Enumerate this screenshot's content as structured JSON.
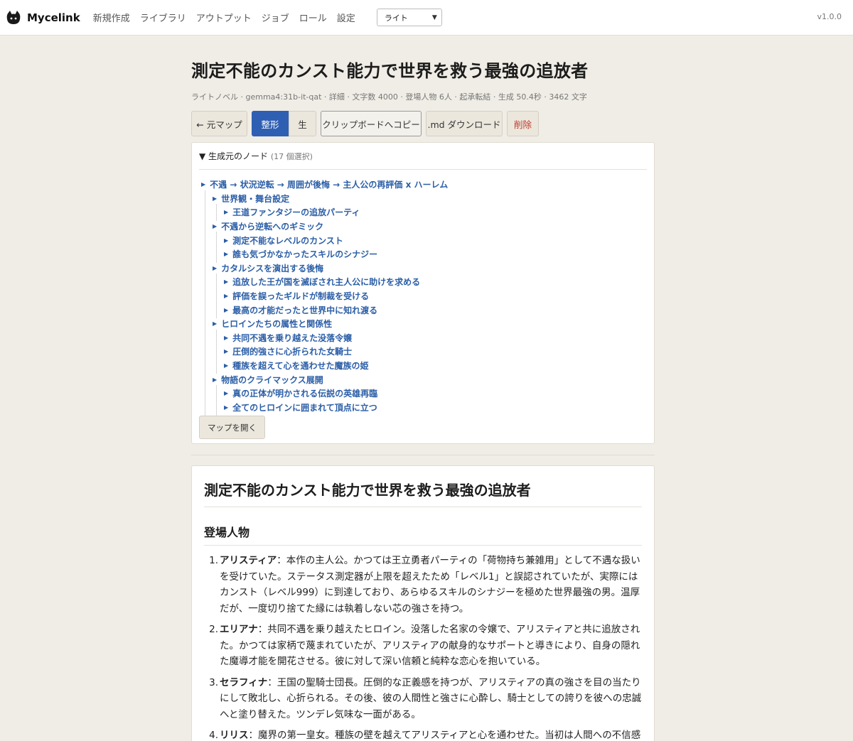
{
  "brand": {
    "name": "Mycelink",
    "icon": "cat-icon"
  },
  "nav": {
    "items": [
      "新規作成",
      "ライブラリ",
      "アウトプット",
      "ジョブ",
      "ロール",
      "設定"
    ],
    "theme_value": "ライト",
    "version": "v1.0.0"
  },
  "page": {
    "title": "測定不能のカンスト能力で世界を救う最強の追放者",
    "meta": "ライトノベル · gemma4:31b-it-qat · 詳細 · 文字数 4000 · 登場人物 6人 · 起承転結 · 生成 50.4秒 · 3462 文字"
  },
  "toolbar": {
    "back": "← 元マップ",
    "formatted": "整形",
    "raw": "生",
    "copy": "クリップボードへコピー",
    "download": ".md ダウンロード",
    "delete": "削除"
  },
  "nodes": {
    "heading": "▼ 生成元のノード",
    "count": "(17 個選択)",
    "tree": [
      {
        "level": 0,
        "label": "不遇 → 状況逆転 → 周囲が後悔 → 主人公の再評価 x ハーレム"
      },
      {
        "level": 1,
        "label": "世界観・舞台設定"
      },
      {
        "level": 2,
        "label": "王道ファンタジーの追放パーティ"
      },
      {
        "level": 1,
        "label": "不遇から逆転へのギミック"
      },
      {
        "level": 2,
        "label": "測定不能なレベルのカンスト"
      },
      {
        "level": 2,
        "label": "誰も気づかなかったスキルのシナジー"
      },
      {
        "level": 1,
        "label": "カタルシスを演出する後悔"
      },
      {
        "level": 2,
        "label": "追放した王が国を滅ぼされ主人公に助けを求める"
      },
      {
        "level": 2,
        "label": "評価を誤ったギルドが制裁を受ける"
      },
      {
        "level": 2,
        "label": "最高の才能だったと世界中に知れ渡る"
      },
      {
        "level": 1,
        "label": "ヒロインたちの属性と関係性"
      },
      {
        "level": 2,
        "label": "共同不遇を乗り越えた没落令嬢"
      },
      {
        "level": 2,
        "label": "圧倒的強さに心折られた女騎士"
      },
      {
        "level": 2,
        "label": "種族を超えて心を通わせた魔族の姫"
      },
      {
        "level": 1,
        "label": "物語のクライマックス展開"
      },
      {
        "level": 2,
        "label": "真の正体が明かされる伝説の英雄再臨"
      },
      {
        "level": 2,
        "label": "全てのヒロインに囲まれて頂点に立つ"
      }
    ],
    "open_map": "マップを開く"
  },
  "doc": {
    "title": "測定不能のカンスト能力で世界を救う最強の追放者",
    "section": "登場人物",
    "characters": [
      {
        "num": "1.",
        "name": "アリスティア",
        "text": "：本作の主人公。かつては王立勇者パーティの「荷物持ち兼雑用」として不遇な扱いを受けていた。ステータス測定器が上限を超えたため「レベル1」と誤認されていたが、実際にはカンスト（レベル999）に到達しており、あらゆるスキルのシナジーを極めた世界最強の男。温厚だが、一度切り捨てた縁には執着しない芯の強さを持つ。"
      },
      {
        "num": "2.",
        "name": "エリアナ",
        "text": "：共同不遇を乗り越えたヒロイン。没落した名家の令嬢で、アリスティアと共に追放された。かつては家柄で蔑まれていたが、アリスティアの献身的なサポートと導きにより、自身の隠れた魔導才能を開花させる。彼に対して深い信頼と純粋な恋心を抱いている。"
      },
      {
        "num": "3.",
        "name": "セラフィナ",
        "text": "：王国の聖騎士団長。圧倒的な正義感を持つが、アリスティアの真の強さを目の当たりにして敗北し、心折られる。その後、彼の人間性と強さに心酔し、騎士としての誇りを彼への忠誠へと塗り替えた。ツンデレ気味な一面がある。"
      },
      {
        "num": "4.",
        "name": "リリス",
        "text": "：魔界の第一皇女。種族の壁を越えてアリスティアと心を通わせた。当初は人間への不信感を持っていたが、アリスティアの圧倒的な力と慈悲深い心に触れ、彼を唯一の理解者として認める。奔放に愛情"
      }
    ]
  }
}
